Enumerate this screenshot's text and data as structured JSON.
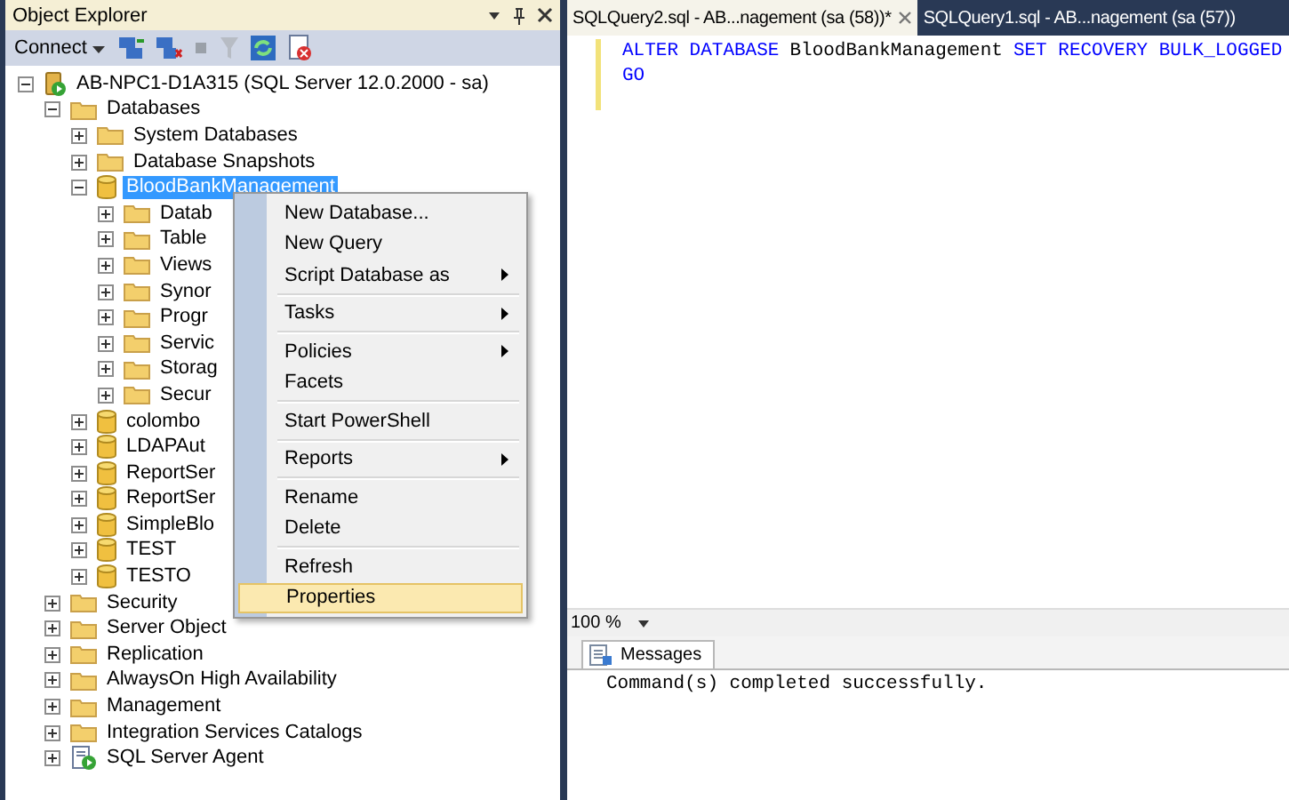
{
  "object_explorer": {
    "title": "Object Explorer",
    "toolbar": {
      "connect": "Connect"
    },
    "tree": [
      {
        "label": "AB-NPC1-D1A315 (SQL Server 12.0.2000 - sa)",
        "kind": "server",
        "expanded": true,
        "selected": false,
        "children": [
          {
            "label": "Databases",
            "kind": "folder",
            "expanded": true,
            "selected": false,
            "children": [
              {
                "label": "System Databases",
                "kind": "folder",
                "expanded": false,
                "selected": false
              },
              {
                "label": "Database Snapshots",
                "kind": "folder",
                "expanded": false,
                "selected": false
              },
              {
                "label": "BloodBankManagement",
                "kind": "database",
                "expanded": true,
                "selected": true,
                "children": [
                  {
                    "label": "Datab",
                    "kind": "folder",
                    "expanded": false,
                    "selected": false
                  },
                  {
                    "label": "Table",
                    "kind": "folder",
                    "expanded": false,
                    "selected": false
                  },
                  {
                    "label": "Views",
                    "kind": "folder",
                    "expanded": false,
                    "selected": false
                  },
                  {
                    "label": "Synor",
                    "kind": "folder",
                    "expanded": false,
                    "selected": false
                  },
                  {
                    "label": "Progr",
                    "kind": "folder",
                    "expanded": false,
                    "selected": false
                  },
                  {
                    "label": "Servic",
                    "kind": "folder",
                    "expanded": false,
                    "selected": false
                  },
                  {
                    "label": "Storag",
                    "kind": "folder",
                    "expanded": false,
                    "selected": false
                  },
                  {
                    "label": "Secur",
                    "kind": "folder",
                    "expanded": false,
                    "selected": false
                  }
                ]
              },
              {
                "label": "colombo",
                "kind": "database",
                "expanded": false,
                "selected": false
              },
              {
                "label": "LDAPAut",
                "kind": "database",
                "expanded": false,
                "selected": false
              },
              {
                "label": "ReportSer",
                "kind": "database",
                "expanded": false,
                "selected": false
              },
              {
                "label": "ReportSer",
                "kind": "database",
                "expanded": false,
                "selected": false
              },
              {
                "label": "SimpleBlo",
                "kind": "database",
                "expanded": false,
                "selected": false
              },
              {
                "label": "TEST",
                "kind": "database",
                "expanded": false,
                "selected": false
              },
              {
                "label": "TESTO",
                "kind": "database",
                "expanded": false,
                "selected": false
              }
            ]
          },
          {
            "label": "Security",
            "kind": "folder",
            "expanded": false,
            "selected": false
          },
          {
            "label": "Server Object",
            "kind": "folder",
            "expanded": false,
            "selected": false
          },
          {
            "label": "Replication",
            "kind": "folder",
            "expanded": false,
            "selected": false
          },
          {
            "label": "AlwaysOn High Availability",
            "kind": "folder",
            "expanded": false,
            "selected": false
          },
          {
            "label": "Management",
            "kind": "folder",
            "expanded": false,
            "selected": false
          },
          {
            "label": "Integration Services Catalogs",
            "kind": "folder",
            "expanded": false,
            "selected": false
          },
          {
            "label": "SQL Server Agent",
            "kind": "agent",
            "expanded": false,
            "selected": false
          }
        ]
      }
    ]
  },
  "context_menu": {
    "items": [
      {
        "kind": "item",
        "label": "New Database...",
        "submenu": false,
        "selected": false
      },
      {
        "kind": "item",
        "label": "New Query",
        "submenu": false,
        "selected": false
      },
      {
        "kind": "item",
        "label": "Script Database as",
        "submenu": true,
        "selected": false
      },
      {
        "kind": "separator"
      },
      {
        "kind": "item",
        "label": "Tasks",
        "submenu": true,
        "selected": false
      },
      {
        "kind": "separator"
      },
      {
        "kind": "item",
        "label": "Policies",
        "submenu": true,
        "selected": false
      },
      {
        "kind": "item",
        "label": "Facets",
        "submenu": false,
        "selected": false
      },
      {
        "kind": "separator"
      },
      {
        "kind": "item",
        "label": "Start PowerShell",
        "submenu": false,
        "selected": false
      },
      {
        "kind": "separator"
      },
      {
        "kind": "item",
        "label": "Reports",
        "submenu": true,
        "selected": false
      },
      {
        "kind": "separator"
      },
      {
        "kind": "item",
        "label": "Rename",
        "submenu": false,
        "selected": false
      },
      {
        "kind": "item",
        "label": "Delete",
        "submenu": false,
        "selected": false
      },
      {
        "kind": "separator"
      },
      {
        "kind": "item",
        "label": "Refresh",
        "submenu": false,
        "selected": false
      },
      {
        "kind": "item",
        "label": "Properties",
        "submenu": false,
        "selected": true
      }
    ]
  },
  "editor": {
    "tabs": [
      {
        "label": "SQLQuery2.sql - AB...nagement (sa (58))*",
        "selected": true
      },
      {
        "label": "SQLQuery1.sql - AB...nagement (sa (57))",
        "selected": false
      }
    ],
    "code": [
      [
        {
          "text": "ALTER DATABASE",
          "kind": "keyword"
        },
        {
          "text": "BloodBankManagement",
          "kind": "identifier"
        },
        {
          "text": "SET RECOVERY BULK_LOGGED",
          "kind": "keyword"
        }
      ],
      [
        {
          "text": "GO",
          "kind": "keyword"
        }
      ]
    ],
    "zoom": "100 %",
    "results": {
      "tab": "Messages",
      "message": "Command(s) completed successfully."
    }
  }
}
